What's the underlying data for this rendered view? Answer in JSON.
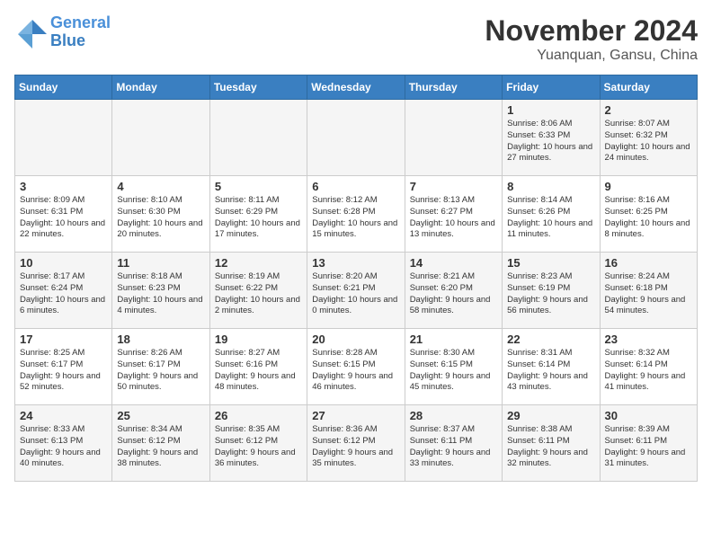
{
  "header": {
    "logo_line1": "General",
    "logo_line2": "Blue",
    "month_title": "November 2024",
    "location": "Yuanquan, Gansu, China"
  },
  "days_of_week": [
    "Sunday",
    "Monday",
    "Tuesday",
    "Wednesday",
    "Thursday",
    "Friday",
    "Saturday"
  ],
  "weeks": [
    [
      {
        "day": "",
        "info": ""
      },
      {
        "day": "",
        "info": ""
      },
      {
        "day": "",
        "info": ""
      },
      {
        "day": "",
        "info": ""
      },
      {
        "day": "",
        "info": ""
      },
      {
        "day": "1",
        "info": "Sunrise: 8:06 AM\nSunset: 6:33 PM\nDaylight: 10 hours and 27 minutes."
      },
      {
        "day": "2",
        "info": "Sunrise: 8:07 AM\nSunset: 6:32 PM\nDaylight: 10 hours and 24 minutes."
      }
    ],
    [
      {
        "day": "3",
        "info": "Sunrise: 8:09 AM\nSunset: 6:31 PM\nDaylight: 10 hours and 22 minutes."
      },
      {
        "day": "4",
        "info": "Sunrise: 8:10 AM\nSunset: 6:30 PM\nDaylight: 10 hours and 20 minutes."
      },
      {
        "day": "5",
        "info": "Sunrise: 8:11 AM\nSunset: 6:29 PM\nDaylight: 10 hours and 17 minutes."
      },
      {
        "day": "6",
        "info": "Sunrise: 8:12 AM\nSunset: 6:28 PM\nDaylight: 10 hours and 15 minutes."
      },
      {
        "day": "7",
        "info": "Sunrise: 8:13 AM\nSunset: 6:27 PM\nDaylight: 10 hours and 13 minutes."
      },
      {
        "day": "8",
        "info": "Sunrise: 8:14 AM\nSunset: 6:26 PM\nDaylight: 10 hours and 11 minutes."
      },
      {
        "day": "9",
        "info": "Sunrise: 8:16 AM\nSunset: 6:25 PM\nDaylight: 10 hours and 8 minutes."
      }
    ],
    [
      {
        "day": "10",
        "info": "Sunrise: 8:17 AM\nSunset: 6:24 PM\nDaylight: 10 hours and 6 minutes."
      },
      {
        "day": "11",
        "info": "Sunrise: 8:18 AM\nSunset: 6:23 PM\nDaylight: 10 hours and 4 minutes."
      },
      {
        "day": "12",
        "info": "Sunrise: 8:19 AM\nSunset: 6:22 PM\nDaylight: 10 hours and 2 minutes."
      },
      {
        "day": "13",
        "info": "Sunrise: 8:20 AM\nSunset: 6:21 PM\nDaylight: 10 hours and 0 minutes."
      },
      {
        "day": "14",
        "info": "Sunrise: 8:21 AM\nSunset: 6:20 PM\nDaylight: 9 hours and 58 minutes."
      },
      {
        "day": "15",
        "info": "Sunrise: 8:23 AM\nSunset: 6:19 PM\nDaylight: 9 hours and 56 minutes."
      },
      {
        "day": "16",
        "info": "Sunrise: 8:24 AM\nSunset: 6:18 PM\nDaylight: 9 hours and 54 minutes."
      }
    ],
    [
      {
        "day": "17",
        "info": "Sunrise: 8:25 AM\nSunset: 6:17 PM\nDaylight: 9 hours and 52 minutes."
      },
      {
        "day": "18",
        "info": "Sunrise: 8:26 AM\nSunset: 6:17 PM\nDaylight: 9 hours and 50 minutes."
      },
      {
        "day": "19",
        "info": "Sunrise: 8:27 AM\nSunset: 6:16 PM\nDaylight: 9 hours and 48 minutes."
      },
      {
        "day": "20",
        "info": "Sunrise: 8:28 AM\nSunset: 6:15 PM\nDaylight: 9 hours and 46 minutes."
      },
      {
        "day": "21",
        "info": "Sunrise: 8:30 AM\nSunset: 6:15 PM\nDaylight: 9 hours and 45 minutes."
      },
      {
        "day": "22",
        "info": "Sunrise: 8:31 AM\nSunset: 6:14 PM\nDaylight: 9 hours and 43 minutes."
      },
      {
        "day": "23",
        "info": "Sunrise: 8:32 AM\nSunset: 6:14 PM\nDaylight: 9 hours and 41 minutes."
      }
    ],
    [
      {
        "day": "24",
        "info": "Sunrise: 8:33 AM\nSunset: 6:13 PM\nDaylight: 9 hours and 40 minutes."
      },
      {
        "day": "25",
        "info": "Sunrise: 8:34 AM\nSunset: 6:12 PM\nDaylight: 9 hours and 38 minutes."
      },
      {
        "day": "26",
        "info": "Sunrise: 8:35 AM\nSunset: 6:12 PM\nDaylight: 9 hours and 36 minutes."
      },
      {
        "day": "27",
        "info": "Sunrise: 8:36 AM\nSunset: 6:12 PM\nDaylight: 9 hours and 35 minutes."
      },
      {
        "day": "28",
        "info": "Sunrise: 8:37 AM\nSunset: 6:11 PM\nDaylight: 9 hours and 33 minutes."
      },
      {
        "day": "29",
        "info": "Sunrise: 8:38 AM\nSunset: 6:11 PM\nDaylight: 9 hours and 32 minutes."
      },
      {
        "day": "30",
        "info": "Sunrise: 8:39 AM\nSunset: 6:11 PM\nDaylight: 9 hours and 31 minutes."
      }
    ]
  ]
}
